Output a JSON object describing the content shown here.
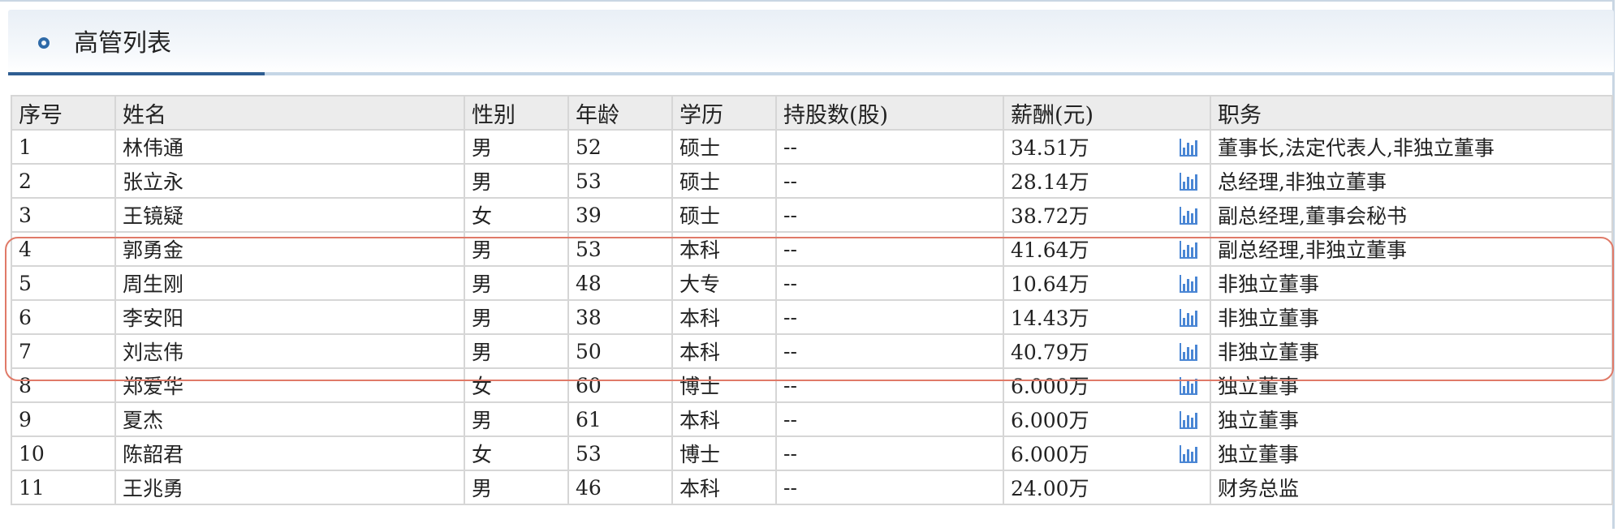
{
  "header": {
    "title": "高管列表"
  },
  "table": {
    "columns": [
      "序号",
      "姓名",
      "性别",
      "年龄",
      "学历",
      "持股数(股)",
      "薪酬(元)",
      "职务"
    ],
    "rows": [
      {
        "no": "1",
        "name": "林伟通",
        "gender": "男",
        "age": "52",
        "edu": "硕士",
        "shares": "--",
        "salary": "34.51万",
        "chart": true,
        "role": "董事长,法定代表人,非独立董事"
      },
      {
        "no": "2",
        "name": "张立永",
        "gender": "男",
        "age": "53",
        "edu": "硕士",
        "shares": "--",
        "salary": "28.14万",
        "chart": true,
        "role": "总经理,非独立董事"
      },
      {
        "no": "3",
        "name": "王镜疑",
        "gender": "女",
        "age": "39",
        "edu": "硕士",
        "shares": "--",
        "salary": "38.72万",
        "chart": true,
        "role": "副总经理,董事会秘书"
      },
      {
        "no": "4",
        "name": "郭勇金",
        "gender": "男",
        "age": "53",
        "edu": "本科",
        "shares": "--",
        "salary": "41.64万",
        "chart": true,
        "role": "副总经理,非独立董事"
      },
      {
        "no": "5",
        "name": "周生刚",
        "gender": "男",
        "age": "48",
        "edu": "大专",
        "shares": "--",
        "salary": "10.64万",
        "chart": true,
        "role": "非独立董事"
      },
      {
        "no": "6",
        "name": "李安阳",
        "gender": "男",
        "age": "38",
        "edu": "本科",
        "shares": "--",
        "salary": "14.43万",
        "chart": true,
        "role": "非独立董事"
      },
      {
        "no": "7",
        "name": "刘志伟",
        "gender": "男",
        "age": "50",
        "edu": "本科",
        "shares": "--",
        "salary": "40.79万",
        "chart": true,
        "role": "非独立董事"
      },
      {
        "no": "8",
        "name": "郑爱华",
        "gender": "女",
        "age": "60",
        "edu": "博士",
        "shares": "--",
        "salary": "6.000万",
        "chart": true,
        "role": "独立董事"
      },
      {
        "no": "9",
        "name": "夏杰",
        "gender": "男",
        "age": "61",
        "edu": "本科",
        "shares": "--",
        "salary": "6.000万",
        "chart": true,
        "role": "独立董事"
      },
      {
        "no": "10",
        "name": "陈韶君",
        "gender": "女",
        "age": "53",
        "edu": "博士",
        "shares": "--",
        "salary": "6.000万",
        "chart": true,
        "role": "独立董事"
      },
      {
        "no": "11",
        "name": "王兆勇",
        "gender": "男",
        "age": "46",
        "edu": "本科",
        "shares": "--",
        "salary": "24.00万",
        "chart": false,
        "role": "财务总监"
      }
    ]
  },
  "icons": {
    "chart": "bar-chart-icon",
    "title": "circle-bullet-icon"
  },
  "colors": {
    "accent": "#2f5e92",
    "chart_icon": "#4a86d4",
    "highlight": "#e07a68"
  }
}
